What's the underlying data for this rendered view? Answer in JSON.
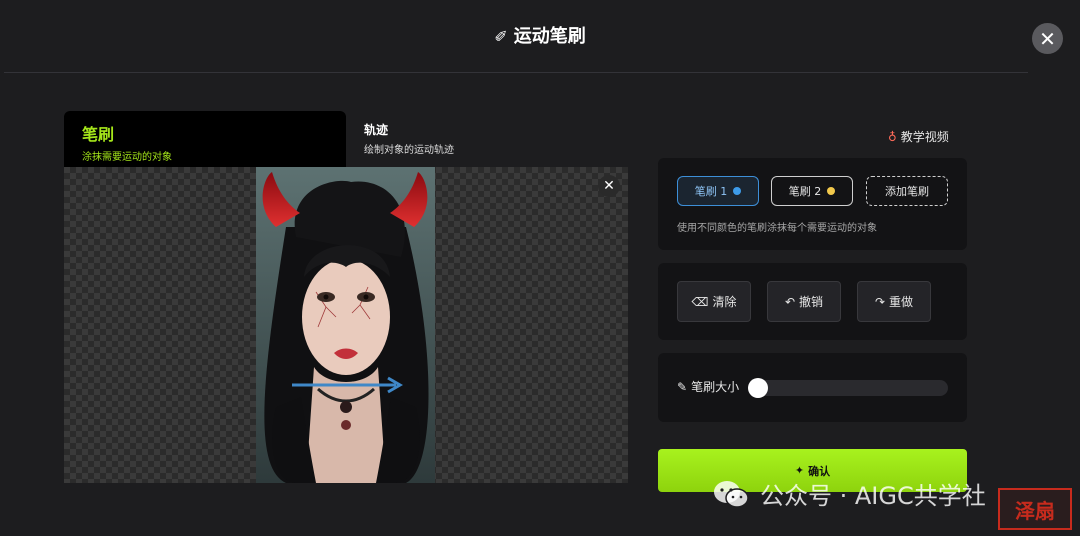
{
  "header": {
    "title": "运动笔刷",
    "close_icon": "close-icon"
  },
  "tabs": {
    "brush": {
      "title": "笔刷",
      "subtitle": "涂抹需要运动的对象"
    },
    "track": {
      "title": "轨迹",
      "subtitle": "绘制对象的运动轨迹"
    }
  },
  "tutorial_label": "教学视频",
  "brush_panel": {
    "chips": [
      {
        "label": "笔刷 1",
        "color": "#3d9be9"
      },
      {
        "label": "笔刷 2",
        "color": "#f2c94c"
      },
      {
        "label": "添加笔刷"
      }
    ],
    "hint": "使用不同颜色的笔刷涂抹每个需要运动的对象"
  },
  "actions": {
    "clear": "清除",
    "undo": "撤销",
    "redo": "重做"
  },
  "brush_size": {
    "label": "笔刷大小",
    "value_fraction": 0.0
  },
  "confirm_label": "确认",
  "accent_color": "#a5e61a",
  "watermark": {
    "text": "公众号 · AIGC共学社",
    "seal_text": "泽扇"
  }
}
